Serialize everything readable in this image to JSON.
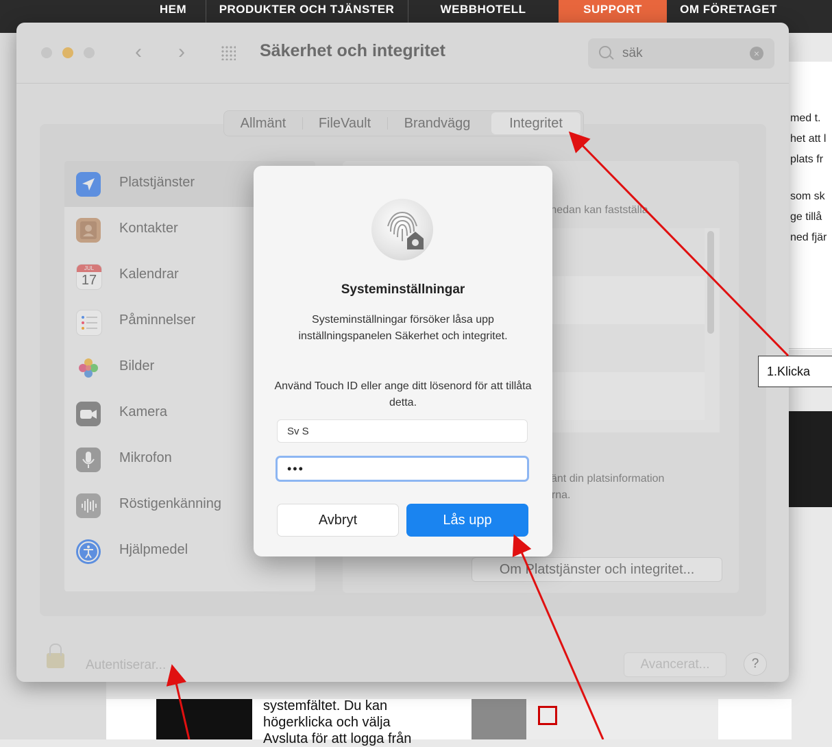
{
  "website": {
    "nav": [
      "HEM",
      "PRODUKTER OCH TJÄNSTER",
      "WEBBHOTELL",
      "SUPPORT",
      "OM FÖRETAGET"
    ],
    "right_text": [
      "med t.",
      "het att l",
      "plats fr",
      "som sk",
      "ge tillå",
      "ned fjär"
    ],
    "bottom_text": [
      "systemfältet. Du kan",
      "högerklicka och välja",
      "Avsluta för att logga från"
    ]
  },
  "window": {
    "title": "Säkerhet och integritet",
    "search_value": "säk",
    "tabs": [
      "Allmänt",
      "FileVault",
      "Brandvägg",
      "Integritet"
    ],
    "active_tab": "Integritet",
    "sidebar": [
      {
        "label": "Platstjänster",
        "icon": "location-arrow-icon",
        "color": "#2f7cf6"
      },
      {
        "label": "Kontakter",
        "icon": "contacts-icon",
        "color": "#c9956a"
      },
      {
        "label": "Kalendrar",
        "icon": "calendar-icon",
        "color": "#ffffff"
      },
      {
        "label": "Påminnelser",
        "icon": "reminders-icon",
        "color": "#ffffff"
      },
      {
        "label": "Bilder",
        "icon": "photos-icon",
        "color": "#f0a030"
      },
      {
        "label": "Kamera",
        "icon": "camera-icon",
        "color": "#6e6e6e"
      },
      {
        "label": "Mikrofon",
        "icon": "microphone-icon",
        "color": "#8c8c8c"
      },
      {
        "label": "Röstigenkänning",
        "icon": "voice-recognition-icon",
        "color": "#9a9a9a"
      },
      {
        "label": "Hjälpmedel",
        "icon": "accessibility-icon",
        "color": "#2f7cf6"
      }
    ],
    "calendar_month": "JUL",
    "calendar_day": "17",
    "right_panel": {
      "text1": "a nedan kan fastställa",
      "text2": "vänt din platsinformation",
      "text3": "erna.",
      "about_button": "Om Platstjänster och integritet..."
    },
    "footer": {
      "auth_text": "Autentiserar...",
      "advanced_button": "Avancerat...",
      "help_button": "?"
    }
  },
  "dialog": {
    "title": "Systeminställningar",
    "message": "Systeminställningar försöker låsa upp inställningspanelen Säkerhet och integritet.",
    "message2": "Använd Touch ID eller ange ditt lösenord för att tillåta detta.",
    "username": "Sv   S",
    "password": "•••",
    "cancel_button": "Avbryt",
    "unlock_button": "Lås upp"
  },
  "annotation": {
    "callout_text": "1.Klicka",
    "arrow_color": "#e01010"
  }
}
